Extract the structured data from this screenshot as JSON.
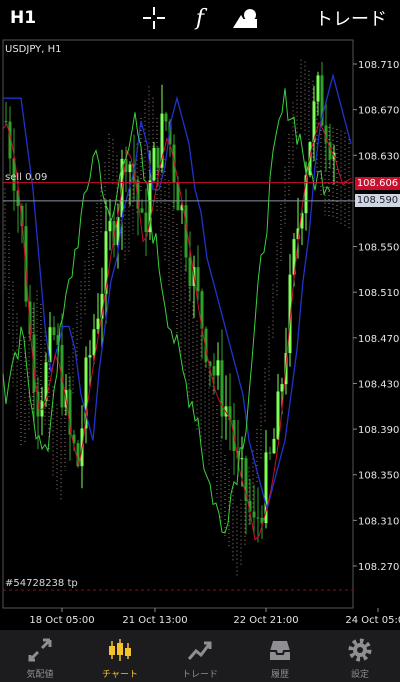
{
  "toolbar": {
    "period": "H1",
    "trade_label": "トレード",
    "crosshair_icon": "crosshair-icon",
    "function_icon": "function-icon",
    "objects_icon": "objects-icon",
    "function_glyph": "f"
  },
  "chart": {
    "symbol_label": "USDJPY, H1",
    "sell_label": "sell 0.09",
    "tp_label": "#54728238 tp",
    "price_axis": [
      "108.710",
      "108.670",
      "108.630",
      "108.590",
      "108.550",
      "108.510",
      "108.470",
      "108.430",
      "108.390",
      "108.350",
      "108.310",
      "108.270"
    ],
    "time_axis": [
      "18 Oct 05:00",
      "21 Oct 13:00",
      "22 Oct 21:00",
      "24 Oct 05:00"
    ],
    "sell_price": "108.606",
    "bid_price": "108.590",
    "colors": {
      "bull": "#7dff5a",
      "bear": "#2fa12a",
      "ask_line": "#c8102e",
      "tp_line": "#8b1010",
      "kumo_dots": "#caa9a0",
      "kijun": "#2233cc",
      "tenkan": "#c8102e",
      "chikou": "#3bd13b"
    }
  },
  "nav": {
    "items": [
      {
        "label": "気配値",
        "icon": "quotes-icon"
      },
      {
        "label": "チャート",
        "icon": "chart-icon"
      },
      {
        "label": "トレード",
        "icon": "trade-icon"
      },
      {
        "label": "履歴",
        "icon": "history-icon"
      },
      {
        "label": "設定",
        "icon": "settings-icon"
      }
    ],
    "active": "チャート"
  }
}
